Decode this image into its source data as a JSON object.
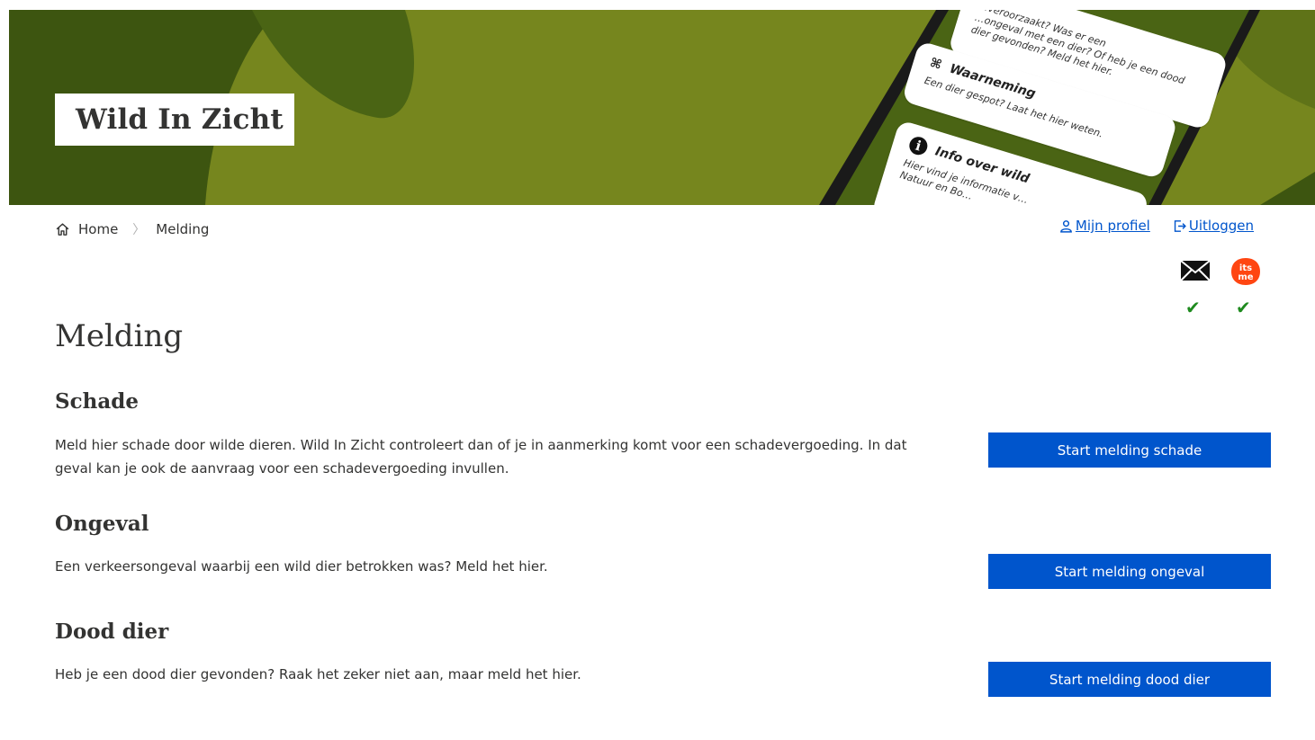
{
  "header": {
    "brand": "Wild In Zicht",
    "phone_cards": [
      {
        "title": "",
        "desc": "…ongeval met een dier? Of heb je een dood dier gevonden? Meld het hier.",
        "desc_top": "…veroorzaakt? Was er een"
      },
      {
        "title": "Waarneming",
        "desc": "Een dier gespot? Laat het hier weten."
      },
      {
        "title": "Info over wild",
        "desc": "Hier vind je informatie v…",
        "desc2": "Natuur en Bo…"
      }
    ]
  },
  "breadcrumb": {
    "home": "Home",
    "current": "Melding"
  },
  "account": {
    "profile": "Mijn profiel",
    "logout": "Uitloggen",
    "itsme_label": "its me",
    "check": "✔"
  },
  "main": {
    "title": "Melding",
    "sections": [
      {
        "heading": "Schade",
        "text": "Meld hier schade door wilde dieren. Wild In Zicht controleert dan of je in aanmerking komt voor een schadevergoeding. In dat geval kan je ook de aanvraag voor een schadevergoeding invullen.",
        "button": "Start melding schade"
      },
      {
        "heading": "Ongeval",
        "text": "Een verkeersongeval waarbij een wild dier betrokken was? Meld het hier.",
        "button": "Start melding ongeval"
      },
      {
        "heading": "Dood dier",
        "text": "Heb je een dood dier gevonden? Raak het zeker niet aan, maar meld het hier.",
        "button": "Start melding dood dier"
      }
    ]
  },
  "colors": {
    "primary": "#0055cc",
    "hero_dark": "#3d5510",
    "hero_light": "#76861e",
    "check": "#1e8a1e",
    "itsme": "#ff4612"
  }
}
